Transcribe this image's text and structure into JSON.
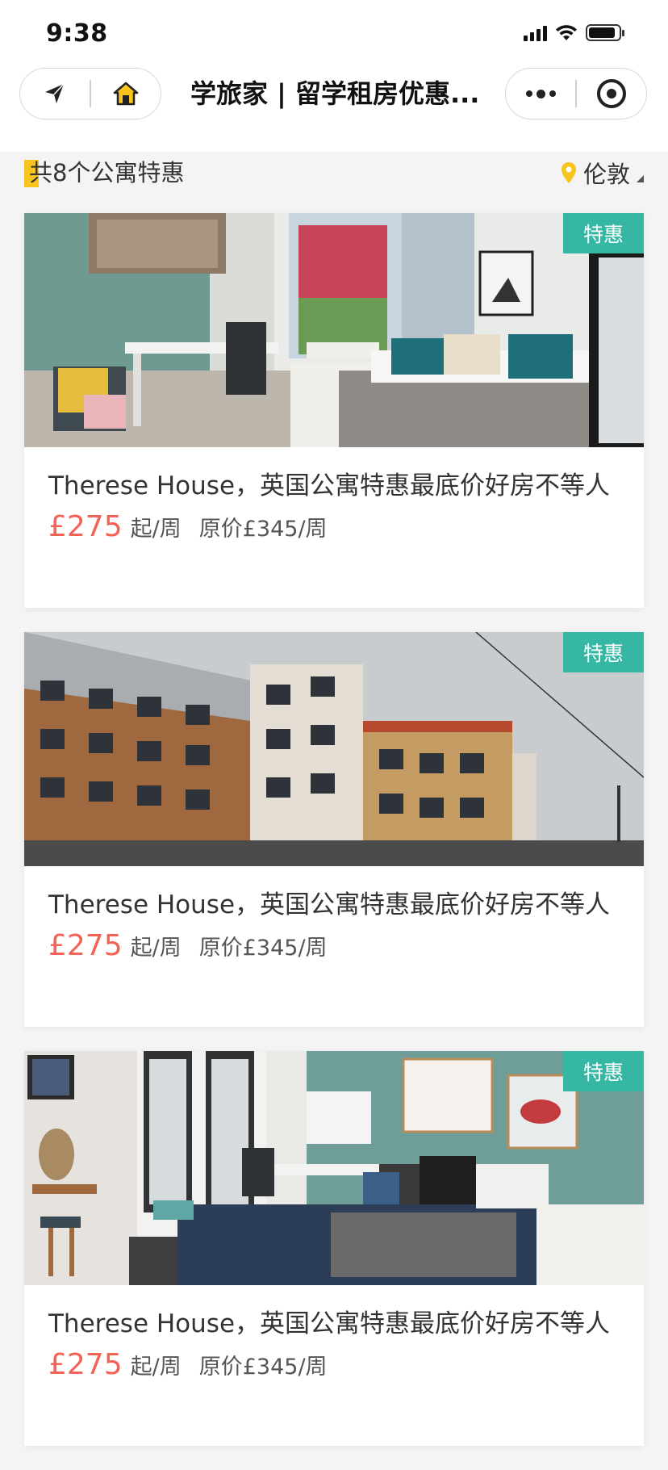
{
  "status_bar": {
    "time": "9:38"
  },
  "nav": {
    "title": "学旅家 | 留学租房优惠..."
  },
  "summary": {
    "count_text": "共8个公寓特惠",
    "city": "伦敦"
  },
  "listings": [
    {
      "badge": "特惠",
      "title": "Therese House，英国公寓特惠最底价好房不等人",
      "price": "£275",
      "unit": "起/周",
      "original": "原价£345/周"
    },
    {
      "badge": "特惠",
      "title": "Therese House，英国公寓特惠最底价好房不等人",
      "price": "£275",
      "unit": "起/周",
      "original": "原价£345/周"
    },
    {
      "badge": "特惠",
      "title": "Therese House，英国公寓特惠最底价好房不等人",
      "price": "£275",
      "unit": "起/周",
      "original": "原价£345/周"
    }
  ],
  "colors": {
    "accent_yellow": "#f7c51e",
    "badge_teal": "#35b7a4",
    "price_red": "#f26255"
  }
}
